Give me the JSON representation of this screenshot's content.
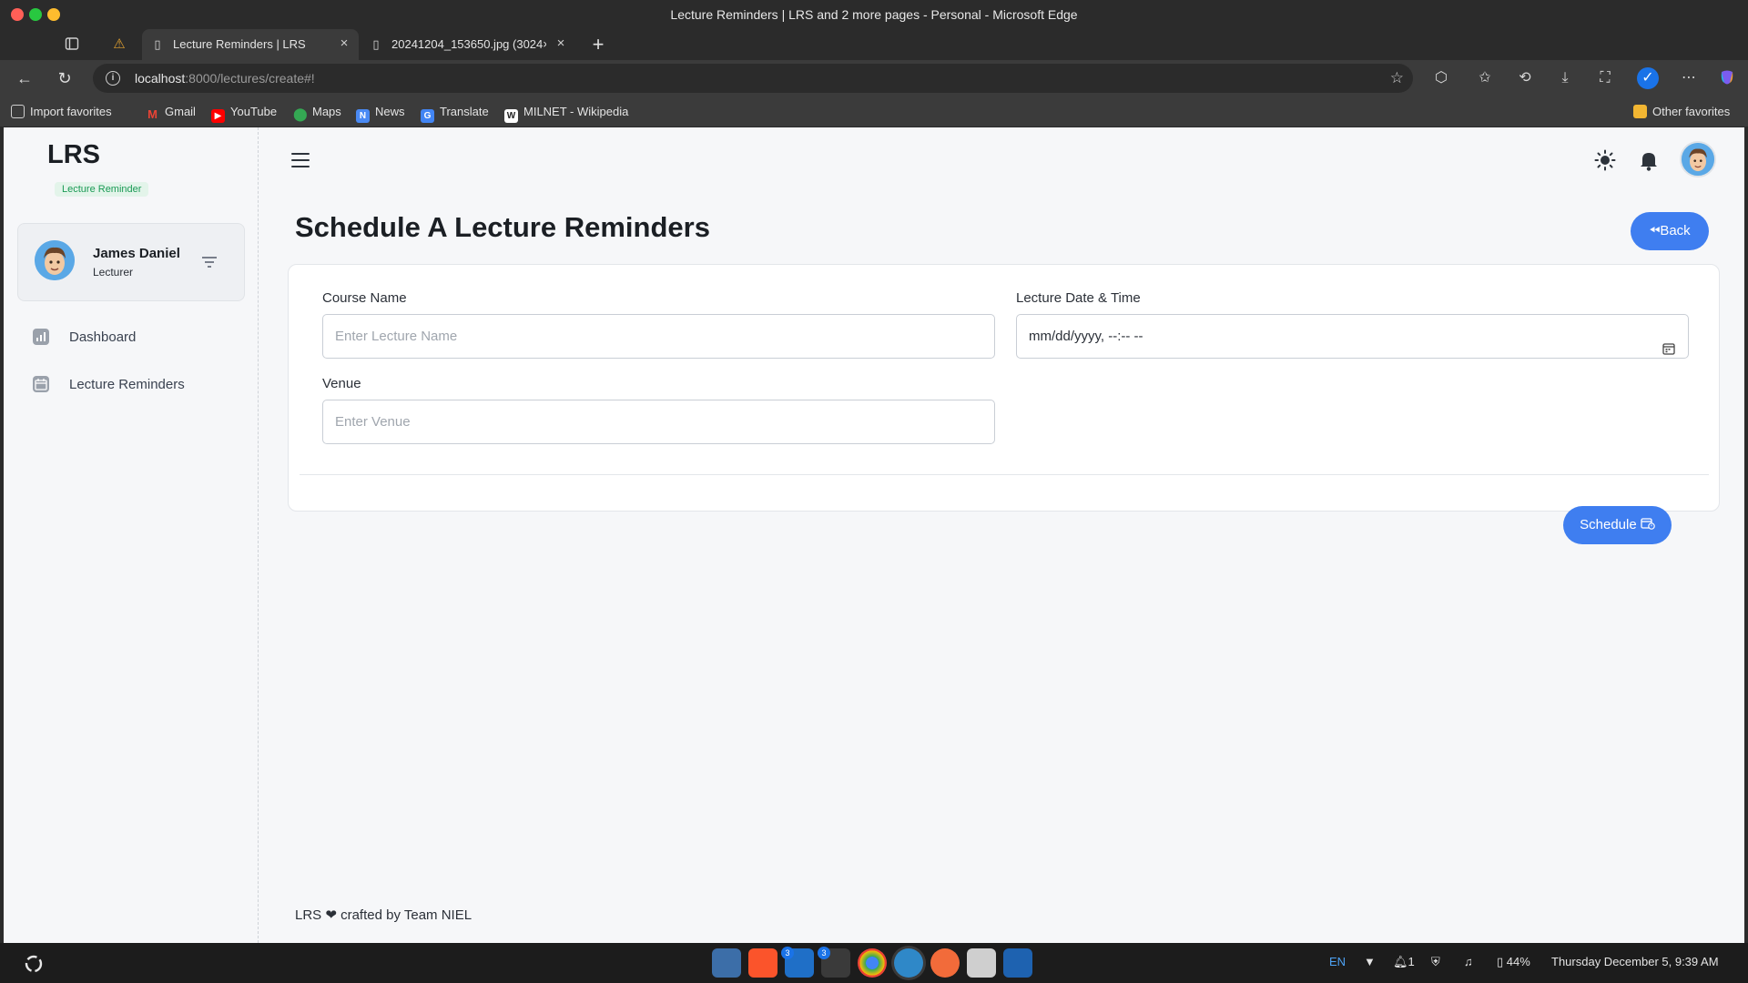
{
  "browser": {
    "window_title": "Lecture Reminders | LRS and 2 more pages - Personal - Microsoft Edge",
    "tabs": [
      {
        "label": "Lecture Reminders | LRS",
        "active": true
      },
      {
        "label": "20241204_153650.jpg (3024×",
        "active": false
      }
    ],
    "url_host": "localhost",
    "url_path": ":8000/lectures/create#!",
    "favorites": [
      {
        "label": "Import favorites",
        "icon": "import-icon"
      },
      {
        "label": "Gmail",
        "icon": "gmail-icon"
      },
      {
        "label": "YouTube",
        "icon": "youtube-icon"
      },
      {
        "label": "Maps",
        "icon": "maps-icon"
      },
      {
        "label": "News",
        "icon": "news-icon"
      },
      {
        "label": "Translate",
        "icon": "translate-icon"
      },
      {
        "label": "MILNET - Wikipedia",
        "icon": "wikipedia-icon"
      }
    ],
    "other_favorites": "Other favorites"
  },
  "sidebar": {
    "brand": "LRS",
    "badge": "Lecture Reminder",
    "user": {
      "name": "James Daniel",
      "role": "Lecturer"
    },
    "items": [
      {
        "label": "Dashboard",
        "icon": "dashboard-icon"
      },
      {
        "label": "Lecture Reminders",
        "icon": "calendar-icon"
      }
    ]
  },
  "main": {
    "title": "Schedule A Lecture Reminders",
    "back_label": "Back",
    "form": {
      "course_label": "Course Name",
      "course_placeholder": "Enter Lecture Name",
      "datetime_label": "Lecture Date & Time",
      "datetime_value": "mm/dd/yyyy, --:-- --",
      "venue_label": "Venue",
      "venue_placeholder": "Enter Venue"
    },
    "schedule_label": "Schedule",
    "footer": "LRS ❤ crafted by Team NIEL"
  },
  "taskbar": {
    "badges": [
      "3",
      "3"
    ],
    "lang": "EN",
    "notifications": "1",
    "battery": "44%",
    "datetime": "Thursday December 5, 9:39 AM"
  },
  "colors": {
    "accent": "#3f7ef0",
    "badge_green": "#1a9a55",
    "sidebar_bg": "#f6f7f9",
    "chrome_bg": "#3b3b3b"
  }
}
